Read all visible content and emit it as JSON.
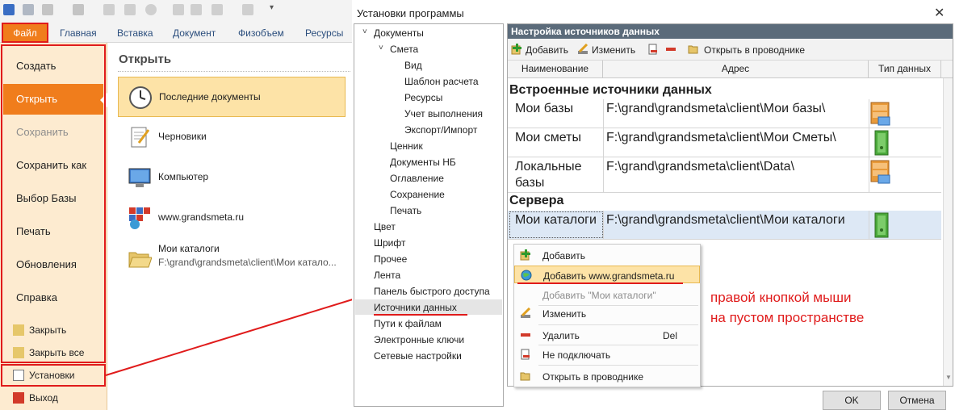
{
  "ribbon": {
    "tabs": [
      "Файл",
      "Главная",
      "Вставка",
      "Документ",
      "Физобъем",
      "Ресурсы"
    ]
  },
  "backstage": {
    "menu": [
      "Создать",
      "Открыть",
      "Сохранить",
      "Сохранить как",
      "Выбор Базы",
      "Печать",
      "Обновления",
      "Справка"
    ],
    "small_menu": [
      "Закрыть",
      "Закрыть все",
      "Установки",
      "Выход"
    ],
    "open_title": "Открыть",
    "open_items": [
      {
        "label": "Последние документы"
      },
      {
        "label": "Черновики"
      },
      {
        "label": "Компьютер"
      },
      {
        "label": "www.grandsmeta.ru"
      },
      {
        "label": "Мои каталоги",
        "sub": "F:\\grand\\grandsmeta\\client\\Мои катало..."
      }
    ]
  },
  "dialog": {
    "title": "Установки программы",
    "close": "✕",
    "tree": {
      "documents": "Документы",
      "smeta": "Смета",
      "smeta_children": [
        "Вид",
        "Шаблон расчета",
        "Ресурсы",
        "Учет выполнения",
        "Экспорт/Импорт"
      ],
      "doc_children": [
        "Ценник",
        "Документы НБ",
        "Оглавление",
        "Сохранение",
        "Печать"
      ],
      "root": [
        "Цвет",
        "Шрифт",
        "Прочее",
        "Лента",
        "Панель быстрого доступа",
        "Источники данных",
        "Пути к файлам",
        "Электронные ключи",
        "Сетевые настройки"
      ]
    },
    "panel": {
      "header": "Настройка источников данных",
      "toolbar": {
        "add": "Добавить",
        "edit": "Изменить",
        "open": "Открыть в проводнике"
      },
      "columns": [
        "Наименование",
        "Адрес",
        "Тип данных"
      ],
      "group_builtin": "Встроенные источники данных",
      "group_servers": "Сервера",
      "rows": [
        {
          "name": "Мои базы",
          "address": "F:\\grand\\grandsmeta\\client\\Мои базы\\"
        },
        {
          "name": "Мои сметы",
          "address": "F:\\grand\\grandsmeta\\client\\Мои Сметы\\"
        },
        {
          "name": "Локальные\nбазы",
          "address": "F:\\grand\\grandsmeta\\client\\Data\\"
        },
        {
          "name": "Мои каталоги",
          "address": "F:\\grand\\grandsmeta\\client\\Мои каталоги"
        }
      ]
    },
    "context_menu": {
      "items": [
        "Добавить",
        "Добавить www.grandsmeta.ru",
        "Добавить \"Мои каталоги\"",
        "Изменить",
        "Удалить",
        "Не подключать",
        "Открыть в проводнике"
      ],
      "delete_key": "Del"
    },
    "buttons": {
      "ok": "OK",
      "cancel": "Отмена"
    }
  },
  "annotation": {
    "line1": "правой кнопкой мыши",
    "line2": "на пустом пространстве"
  },
  "colors": {
    "accent": "#f07d1c",
    "annotation": "#e01b1b",
    "header": "#5b6b7a"
  }
}
